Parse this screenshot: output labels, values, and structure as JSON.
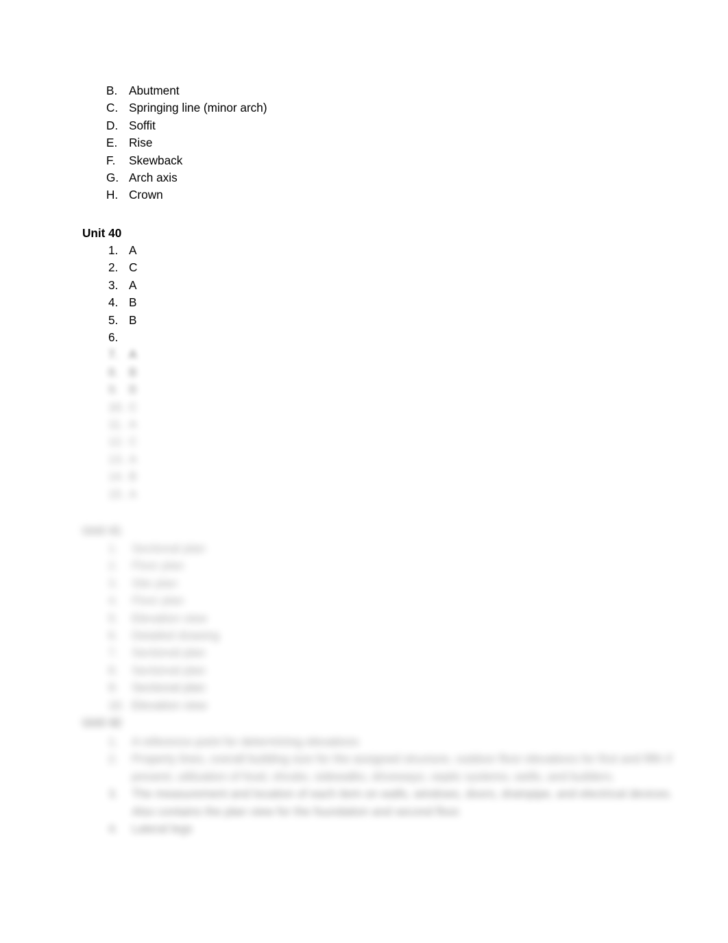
{
  "document": {
    "page_background": "#ffffff",
    "text_color": "#000000"
  },
  "section_arch_parts": {
    "items": [
      {
        "marker": "B.",
        "text": "Abutment"
      },
      {
        "marker": "C.",
        "text": "Springing line (minor arch)"
      },
      {
        "marker": "D.",
        "text": "Soffit"
      },
      {
        "marker": "E.",
        "text": "Rise"
      },
      {
        "marker": "F.",
        "text": "Skewback"
      },
      {
        "marker": "G.",
        "text": "Arch axis"
      },
      {
        "marker": "H.",
        "text": "Crown"
      }
    ]
  },
  "section_unit_40": {
    "heading": "Unit 40",
    "items": [
      {
        "marker": "1.",
        "text": "A"
      },
      {
        "marker": "2.",
        "text": "C"
      },
      {
        "marker": "3.",
        "text": "A"
      },
      {
        "marker": "4.",
        "text": "B"
      },
      {
        "marker": "5.",
        "text": "B"
      },
      {
        "marker": "6.",
        "text": ""
      },
      {
        "marker": "7.",
        "text": "A"
      },
      {
        "marker": "8.",
        "text": "B"
      },
      {
        "marker": "9.",
        "text": "B"
      },
      {
        "marker": "10.",
        "text": "C"
      },
      {
        "marker": "11.",
        "text": "A"
      },
      {
        "marker": "12.",
        "text": "C"
      },
      {
        "marker": "13.",
        "text": "A"
      },
      {
        "marker": "14.",
        "text": "B"
      },
      {
        "marker": "15.",
        "text": "A"
      }
    ]
  },
  "section_unit_41": {
    "heading": "Unit 41",
    "items": [
      {
        "marker": "1.",
        "text": "Sectional plan"
      },
      {
        "marker": "2.",
        "text": "Floor plan"
      },
      {
        "marker": "3.",
        "text": "Site plan"
      },
      {
        "marker": "4.",
        "text": "Floor plan"
      },
      {
        "marker": "5.",
        "text": "Elevation view"
      },
      {
        "marker": "6.",
        "text": "Detailed drawing"
      },
      {
        "marker": "7.",
        "text": "Sectional plan"
      },
      {
        "marker": "8.",
        "text": "Sectional plan"
      },
      {
        "marker": "9.",
        "text": "Sectional plan"
      },
      {
        "marker": "10.",
        "text": "Elevation view"
      }
    ]
  },
  "section_unit_42": {
    "heading": "Unit 42",
    "items": [
      {
        "marker": "1.",
        "text": "A reference point for determining elevations"
      },
      {
        "marker": "2.",
        "text": "Property lines, overall building size for the assigned structure, outdoor floor elevations for first and fifth if present, utilization of food, shrubs, sidewalks, driveways, septic systems, wells, and builders."
      },
      {
        "marker": "3.",
        "text": "The measurement and location of each item on walls, windows, doors, drainpipe, and electrical devices. Also contains the plan view for the foundation and second floor."
      },
      {
        "marker": "4.",
        "text": "Lateral legs"
      }
    ]
  }
}
